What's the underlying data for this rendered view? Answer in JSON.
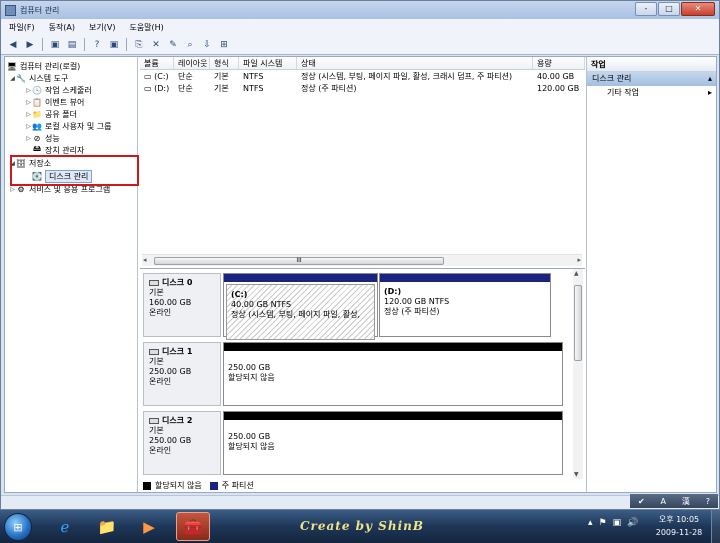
{
  "window": {
    "title": "컴퓨터 관리",
    "controls": [
      "-",
      "□",
      "✕"
    ]
  },
  "menu": [
    "파일(F)",
    "동작(A)",
    "보기(V)",
    "도움말(H)"
  ],
  "toolbar_glyphs": [
    "◀",
    "▶",
    "▣",
    "▤",
    "?",
    "▣",
    "⎘",
    "✕",
    "✎",
    "⌕",
    "⇩",
    "⊞"
  ],
  "tree": {
    "root": "컴퓨터 관리(로컬)",
    "system_tools": "시스템 도구",
    "task_scheduler": "작업 스케줄러",
    "event_viewer": "이벤트 뷰어",
    "shared_folders": "공유 폴더",
    "local_users": "로컬 사용자 및 그룹",
    "performance": "성능",
    "device_manager": "장치 관리자",
    "storage": "저장소",
    "disk_management": "디스크 관리",
    "services": "서비스 및 응용 프로그램"
  },
  "volume_list": {
    "columns": [
      "볼륨",
      "레이아웃",
      "형식",
      "파일 시스템",
      "상태",
      "용량"
    ],
    "rows": [
      {
        "volume": "(C:)",
        "layout": "단순",
        "type": "기본",
        "fs": "NTFS",
        "status": "정상 (시스템, 부팅, 페이지 파일, 활성, 크래시 덤프, 주 파티션)",
        "capacity": "40.00 GB"
      },
      {
        "volume": "(D:)",
        "layout": "단순",
        "type": "기본",
        "fs": "NTFS",
        "status": "정상 (주 파티션)",
        "capacity": "120.00 GB"
      }
    ]
  },
  "scroll_label": "III",
  "disks": [
    {
      "name": "디스크 0",
      "kind": "기본",
      "size": "160.00 GB",
      "state": "온라인",
      "partitions": [
        {
          "label": "(C:)",
          "size": "40.00 GB NTFS",
          "status": "정상 (시스템, 부팅, 페이지 파일, 활성,"
        },
        {
          "label": "(D:)",
          "size": "120.00 GB NTFS",
          "status": "정상 (주 파티션)"
        }
      ]
    },
    {
      "name": "디스크 1",
      "kind": "기본",
      "size": "250.00 GB",
      "state": "온라인",
      "unalloc_size": "250.00 GB",
      "unalloc_label": "할당되지 않음"
    },
    {
      "name": "디스크 2",
      "kind": "기본",
      "size": "250.00 GB",
      "state": "온라인",
      "unalloc_size": "250.00 GB",
      "unalloc_label": "할당되지 않음"
    }
  ],
  "legend": {
    "unallocated": "할당되지 않음",
    "primary": "주 파티션"
  },
  "actions": {
    "header": "작업",
    "section": "디스크 관리",
    "more": "기타 작업"
  },
  "language_bar": {
    "lang": "A",
    "mode": "漢",
    "help": "?"
  },
  "taskbar": {
    "brand": "Create by ShinB",
    "clock_period": "오후 10:05",
    "date": "2009-11-28"
  },
  "colors": {
    "primary_partition_bar": "#1a237e",
    "unallocated_bar": "#000000",
    "selection_box": "#d01818"
  }
}
